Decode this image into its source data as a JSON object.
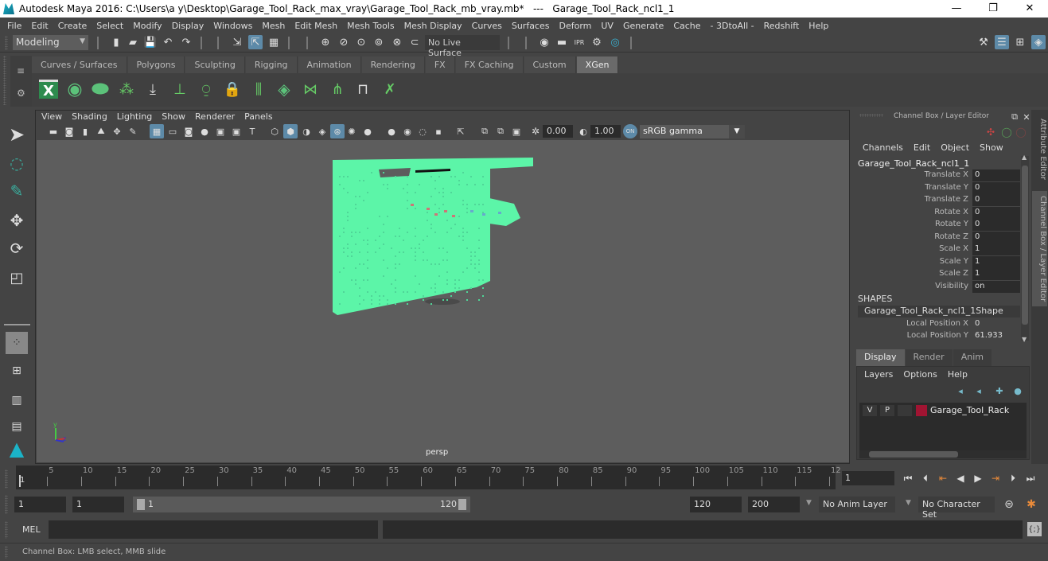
{
  "window": {
    "title": "Autodesk Maya 2016: C:\\Users\\a y\\Desktop\\Garage_Tool_Rack_max_vray\\Garage_Tool_Rack_mb_vray.mb*   ---   Garage_Tool_Rack_ncl1_1",
    "minimize": "—",
    "maximize": "❐",
    "close": "✕"
  },
  "menubar": [
    "File",
    "Edit",
    "Create",
    "Select",
    "Modify",
    "Display",
    "Windows",
    "Mesh",
    "Edit Mesh",
    "Mesh Tools",
    "Mesh Display",
    "Curves",
    "Surfaces",
    "Deform",
    "UV",
    "Generate",
    "Cache",
    "- 3DtoAll -",
    "Redshift",
    "Help"
  ],
  "statusline": {
    "mode": "Modeling",
    "live_surface": "No Live Surface"
  },
  "shelf": {
    "tabs": [
      "Curves / Surfaces",
      "Polygons",
      "Sculpting",
      "Rigging",
      "Animation",
      "Rendering",
      "FX",
      "FX Caching",
      "Custom",
      "XGen"
    ],
    "active_tab": "XGen"
  },
  "viewport": {
    "menu": [
      "View",
      "Shading",
      "Lighting",
      "Show",
      "Renderer",
      "Panels"
    ],
    "exposure": "0.00",
    "gamma": "1.00",
    "color_space": "sRGB gamma",
    "camera_label": "persp",
    "axis": {
      "x": "x",
      "y": "y",
      "z": "z"
    },
    "mesh_color": "#5cf5a8"
  },
  "channel_box": {
    "title": "Channel Box / Layer Editor",
    "menu": [
      "Channels",
      "Edit",
      "Object",
      "Show"
    ],
    "object_name": "Garage_Tool_Rack_ncl1_1",
    "attributes": [
      {
        "label": "Translate X",
        "value": "0"
      },
      {
        "label": "Translate Y",
        "value": "0"
      },
      {
        "label": "Translate Z",
        "value": "0"
      },
      {
        "label": "Rotate X",
        "value": "0"
      },
      {
        "label": "Rotate Y",
        "value": "0"
      },
      {
        "label": "Rotate Z",
        "value": "0"
      },
      {
        "label": "Scale X",
        "value": "1"
      },
      {
        "label": "Scale Y",
        "value": "1"
      },
      {
        "label": "Scale Z",
        "value": "1"
      },
      {
        "label": "Visibility",
        "value": "on"
      }
    ],
    "shapes_label": "SHAPES",
    "shape_name": "Garage_Tool_Rack_ncl1_1Shape",
    "shape_attributes": [
      {
        "label": "Local Position X",
        "value": "0"
      },
      {
        "label": "Local Position Y",
        "value": "61.933"
      }
    ]
  },
  "side_tabs": [
    "Attribute Editor",
    "Channel Box / Layer Editor"
  ],
  "layer_editor": {
    "tabs": [
      "Display",
      "Render",
      "Anim"
    ],
    "active_tab": "Display",
    "menu": [
      "Layers",
      "Options",
      "Help"
    ],
    "layers": [
      {
        "v": "V",
        "p": "P",
        "name": "Garage_Tool_Rack",
        "color": "#a01432"
      }
    ]
  },
  "timeline": {
    "ticks": [
      "5",
      "10",
      "15",
      "20",
      "25",
      "30",
      "35",
      "40",
      "45",
      "50",
      "55",
      "60",
      "65",
      "70",
      "75",
      "80",
      "85",
      "90",
      "95",
      "100",
      "105",
      "110",
      "115",
      "12"
    ],
    "current_frame_marker": "1",
    "current_frame": "1"
  },
  "range": {
    "start": "1",
    "playback_start": "1",
    "slider_start": "1",
    "slider_end": "120",
    "playback_end": "120",
    "end": "200",
    "anim_layer": "No Anim Layer",
    "character_set": "No Character Set"
  },
  "command_line": {
    "label": "MEL"
  },
  "help_line": "Channel Box: LMB select, MMB slide"
}
